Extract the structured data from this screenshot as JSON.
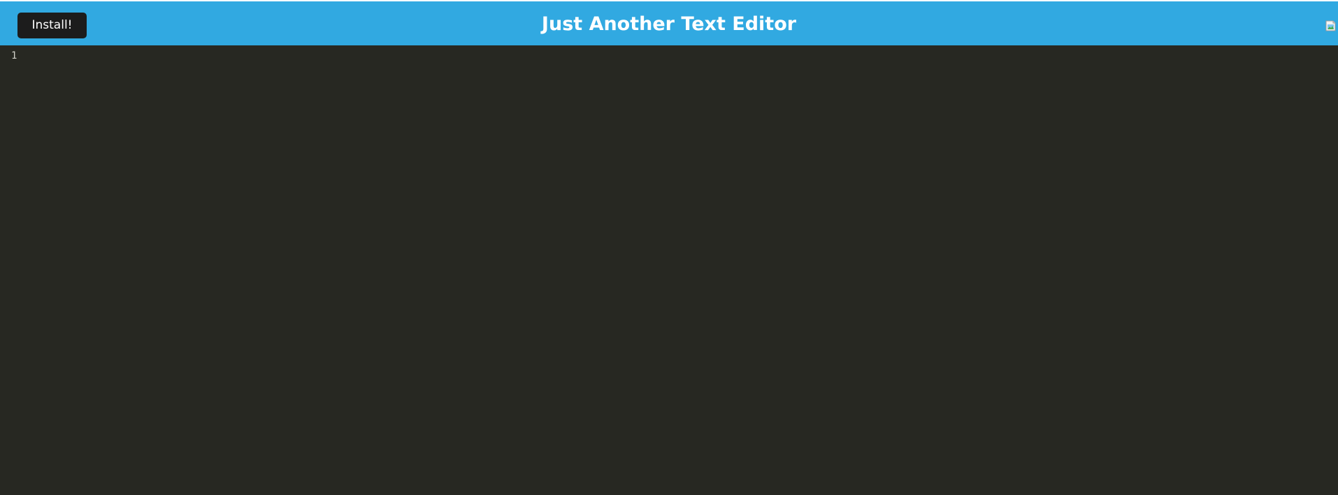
{
  "header": {
    "install_label": "Install!",
    "title": "Just Another Text Editor",
    "logo_icon": "broken-image-icon"
  },
  "editor": {
    "line_numbers": [
      "1"
    ],
    "content": ""
  },
  "colors": {
    "header_bg": "#31a9e1",
    "editor_bg": "#272822",
    "button_bg": "#1c1c1c",
    "text": "#ffffff"
  }
}
